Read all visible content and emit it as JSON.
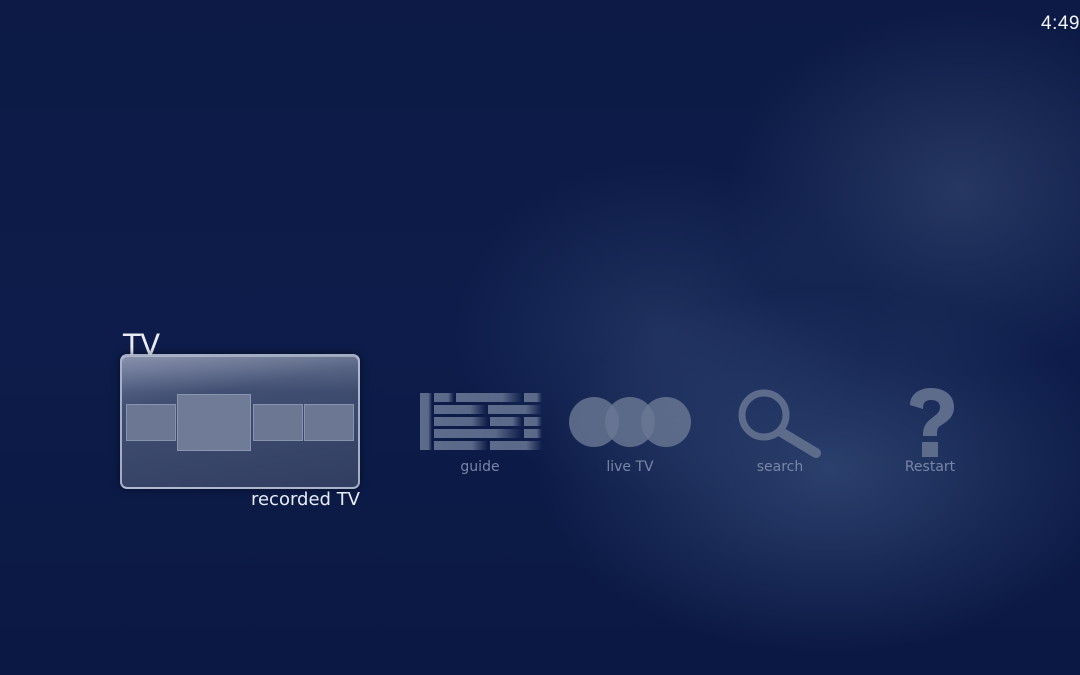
{
  "clock": {
    "time": "4:49"
  },
  "section": {
    "title": "TV"
  },
  "menu": {
    "items": [
      {
        "label": "recorded TV",
        "icon": "recorded-tv-icon",
        "selected": true
      },
      {
        "label": "guide",
        "icon": "guide-grid-icon",
        "selected": false
      },
      {
        "label": "live TV",
        "icon": "live-tv-circles-icon",
        "selected": false
      },
      {
        "label": "search",
        "icon": "magnifier-icon",
        "selected": false
      },
      {
        "label": "Restart",
        "icon": "question-mark-icon",
        "selected": false
      }
    ]
  },
  "colors": {
    "background": "#0c1a45",
    "icon_fill": "#5e6c8c",
    "label_inactive": "#7886a6",
    "label_active": "#e8ecf4"
  }
}
